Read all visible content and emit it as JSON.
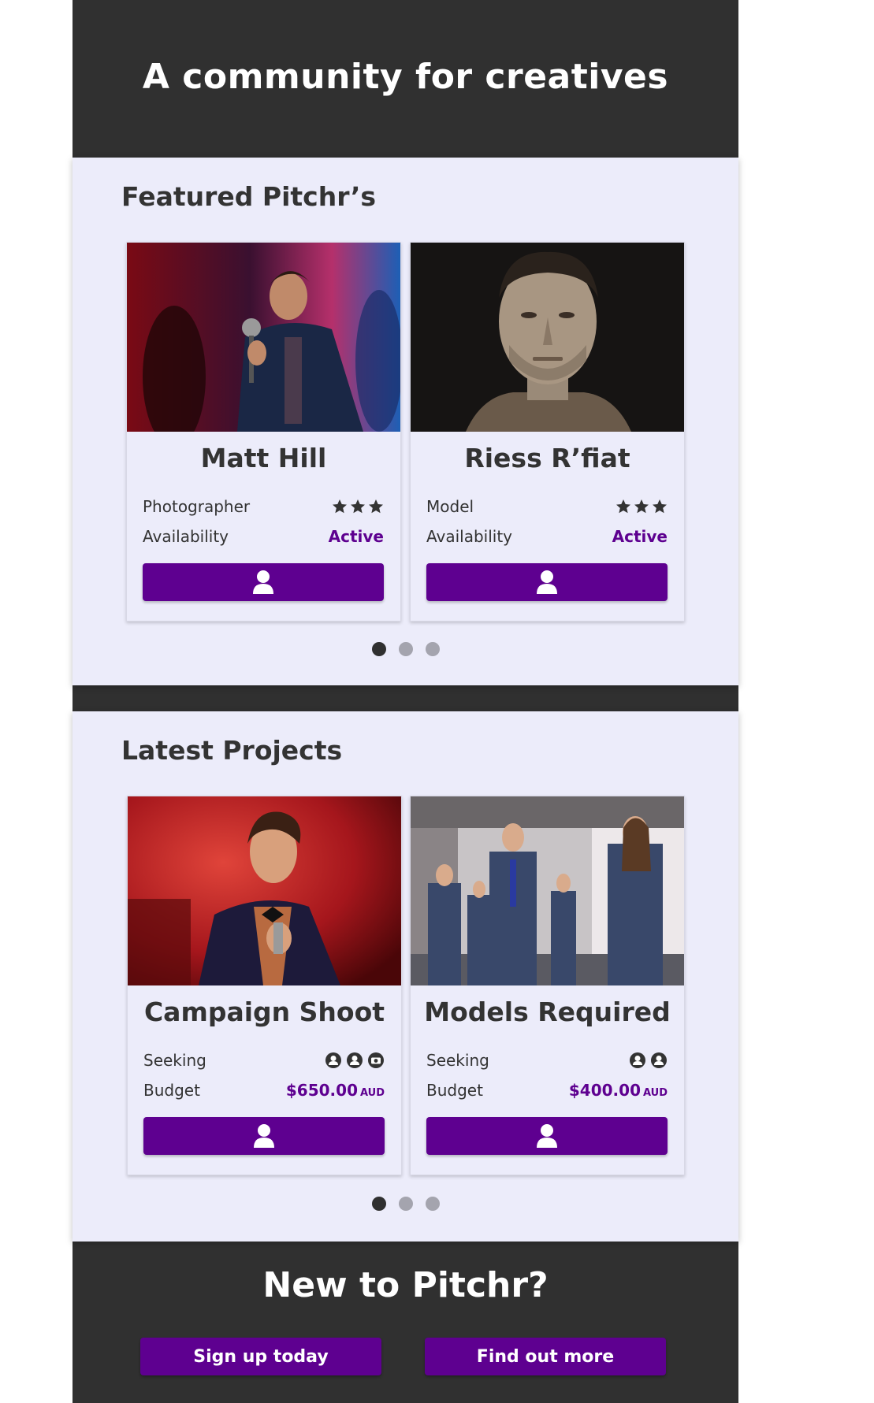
{
  "hero": {
    "title": "A community for creatives"
  },
  "featured": {
    "title": "Featured Pitchr’s",
    "cards": [
      {
        "name": "Matt Hill",
        "role": "Photographer",
        "rating_stars": 3,
        "availability_label": "Availability",
        "availability_value": "Active",
        "button_icon": "user-icon"
      },
      {
        "name": "Riess R’fiat",
        "role": "Model",
        "rating_stars": 3,
        "availability_label": "Availability",
        "availability_value": "Active",
        "button_icon": "user-icon"
      }
    ],
    "carousel": {
      "pages": 3,
      "active_page": 1
    }
  },
  "projects": {
    "title": "Latest Projects",
    "cards": [
      {
        "name": "Campaign Shoot",
        "seeking_label": "Seeking",
        "seeking_icons": [
          "person-icon",
          "person-icon",
          "camera-icon"
        ],
        "budget_label": "Budget",
        "budget_value": "$650.00",
        "currency": "AUD",
        "button_icon": "user-icon"
      },
      {
        "name": "Models Required",
        "seeking_label": "Seeking",
        "seeking_icons": [
          "person-icon",
          "person-icon"
        ],
        "budget_label": "Budget",
        "budget_value": "$400.00",
        "currency": "AUD",
        "button_icon": "user-icon"
      }
    ],
    "carousel": {
      "pages": 3,
      "active_page": 1
    }
  },
  "footer": {
    "title": "New to Pitchr?",
    "signup_label": "Sign up today",
    "find_out_label": "Find out more"
  },
  "colors": {
    "accent": "#5e0090",
    "dark": "#303030",
    "panel": "#ececfa",
    "text": "#333333"
  }
}
